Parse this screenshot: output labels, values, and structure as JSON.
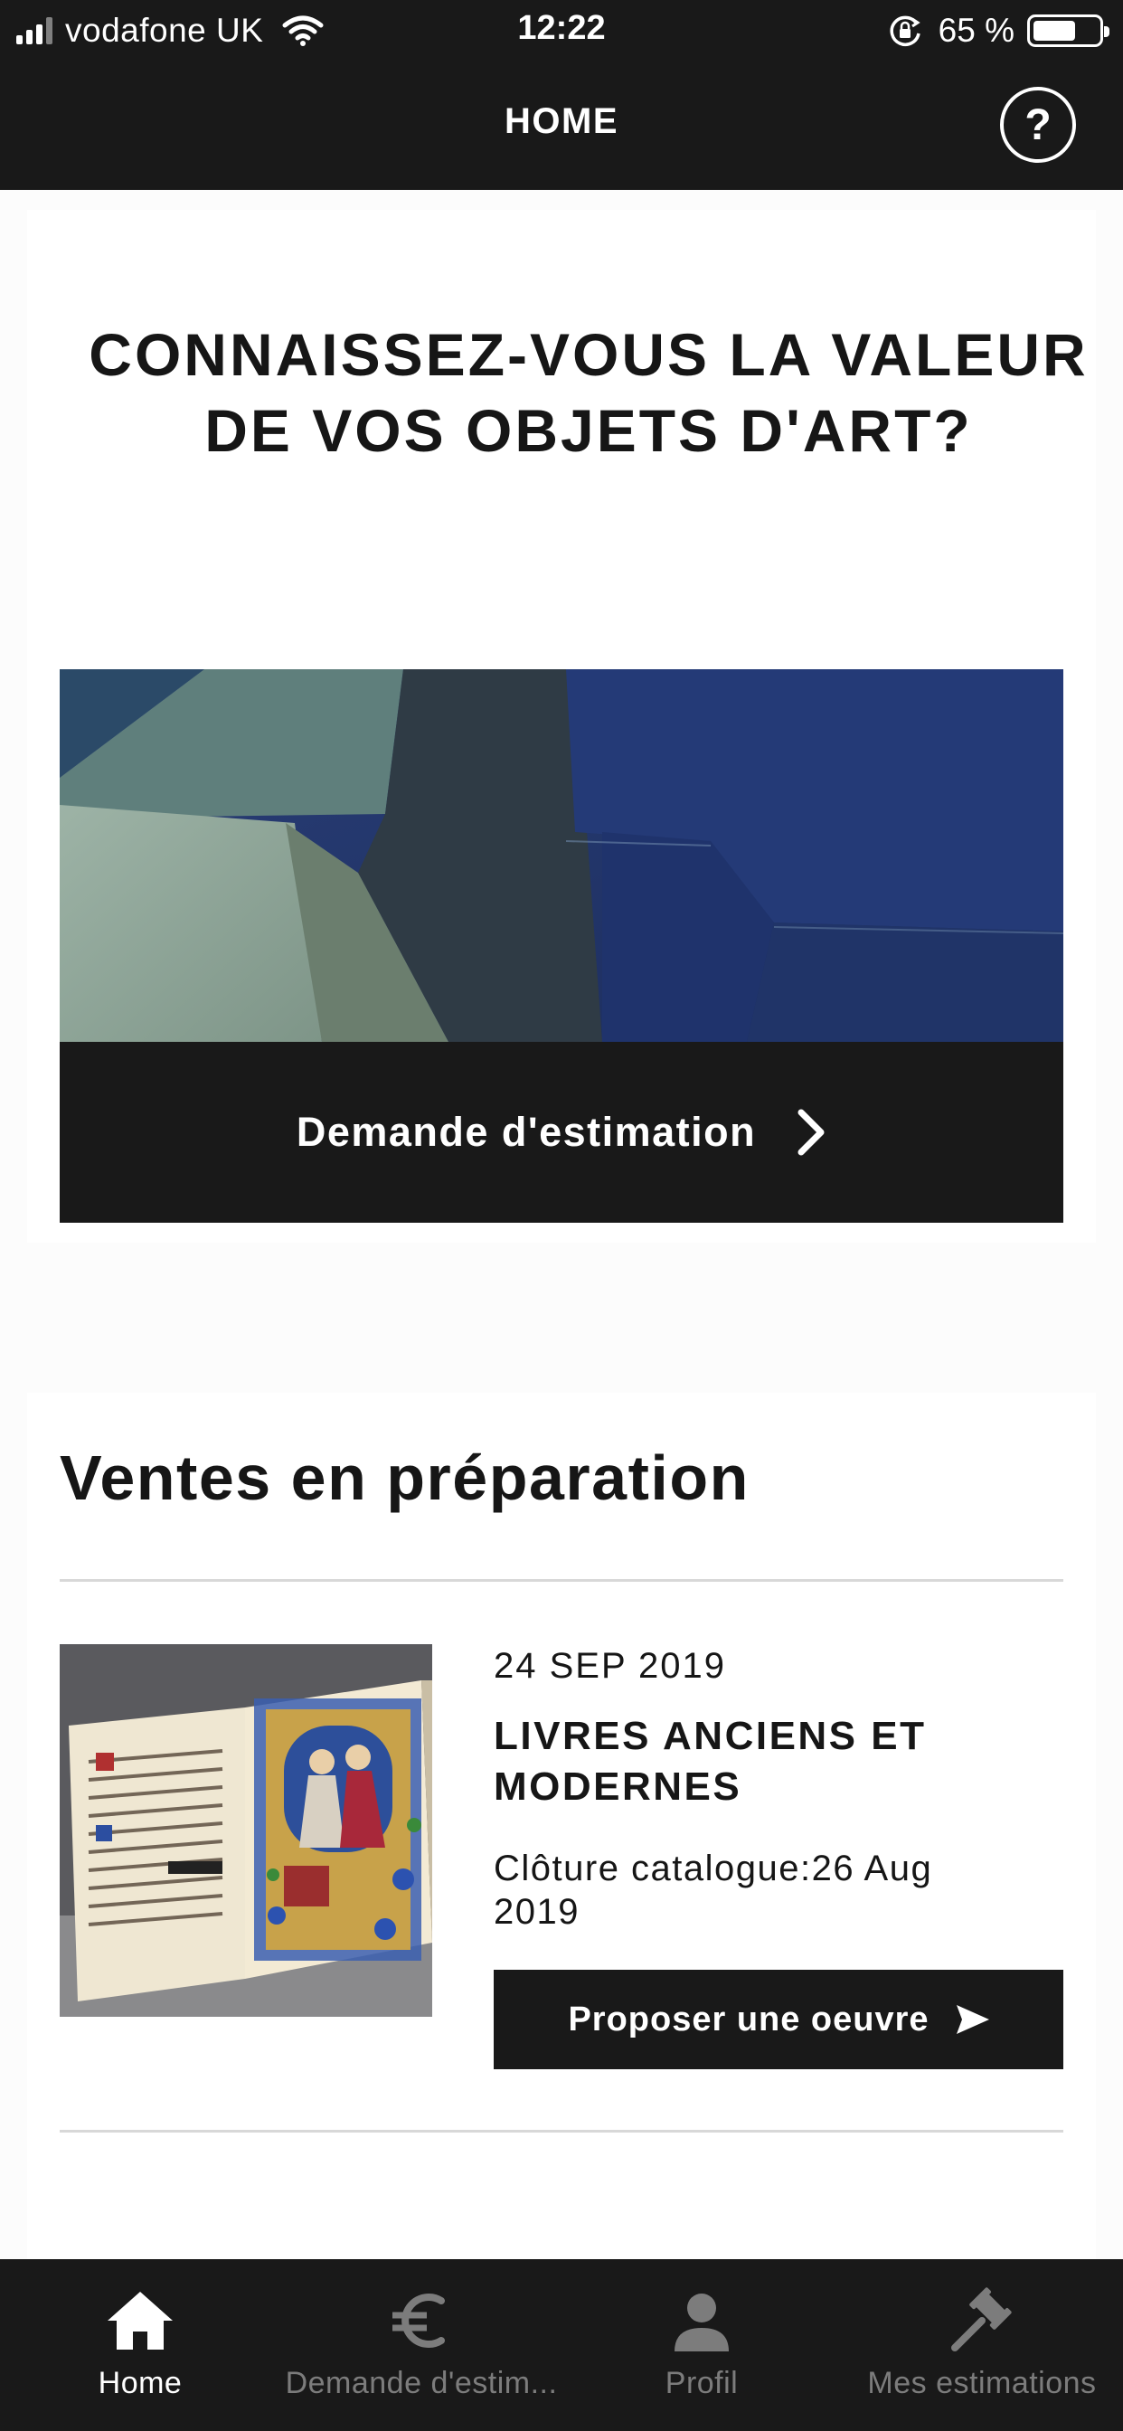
{
  "status_bar": {
    "carrier": "vodafone UK",
    "time": "12:22",
    "battery": "65 %",
    "battery_level": 0.65,
    "icons": [
      "signal-icon",
      "wifi-icon",
      "rotation-lock-icon",
      "battery-icon"
    ]
  },
  "nav": {
    "title": "HOME",
    "help_label": "?"
  },
  "hero": {
    "title": "CONNAISSEZ-VOUS LA VALEUR DE VOS OBJETS D'ART?",
    "image_desc": "abstract painting",
    "cta_label": "Demande d'estimation",
    "cta_icon": "chevron-right-icon"
  },
  "sales": {
    "title": "Ventes en préparation",
    "items": [
      {
        "date": "24 SEP 2019",
        "name": "LIVRES ANCIENS ET MODERNES",
        "cloture": "Clôture catalogue:26 Aug 2019",
        "button_label": "Proposer une oeuvre",
        "button_icon": "send-icon"
      }
    ]
  },
  "tabbar": {
    "active_color": "#ffffff",
    "inactive_color": "#7c7c7c",
    "tabs": [
      {
        "label": "Home",
        "icon": "home-icon",
        "active": true
      },
      {
        "label": "Demande d'estim...",
        "icon": "euro-icon",
        "active": false
      },
      {
        "label": "Profil",
        "icon": "profile-icon",
        "active": false
      },
      {
        "label": "Mes estimations",
        "icon": "gavel-icon",
        "active": false
      }
    ]
  },
  "colors": {
    "bar_background": "#191919",
    "page_background": "#fcfcfc",
    "card_background": "#ffffff",
    "text": "#161616"
  }
}
